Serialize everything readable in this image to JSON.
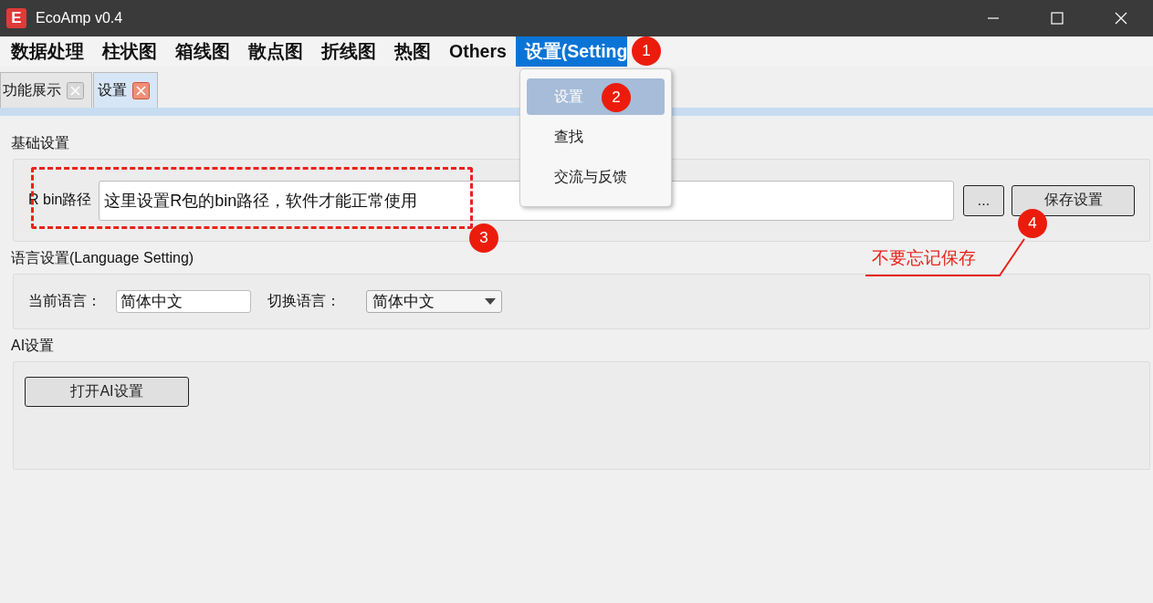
{
  "window": {
    "logo_letter": "E",
    "title": "EcoAmp v0.4"
  },
  "menu_bar": [
    {
      "label": "数据处理",
      "selected": false
    },
    {
      "label": "柱状图",
      "selected": false
    },
    {
      "label": "箱线图",
      "selected": false
    },
    {
      "label": "散点图",
      "selected": false
    },
    {
      "label": "折线图",
      "selected": false
    },
    {
      "label": "热图",
      "selected": false
    },
    {
      "label": "Others",
      "selected": false
    },
    {
      "label": "设置(Setting",
      "selected": true
    }
  ],
  "dropdown_menu": [
    {
      "label": "设置",
      "selected": true
    },
    {
      "label": "查找",
      "selected": false
    },
    {
      "label": "交流与反馈",
      "selected": false
    }
  ],
  "tabs": [
    {
      "label": "功能展示",
      "selected": false
    },
    {
      "label": "设置",
      "selected": true
    }
  ],
  "basic_settings": {
    "title": "基础设置",
    "path_label": "R bin路径",
    "path_value": "这里设置R包的bin路径，软件才能正常使用",
    "browse_button": "...",
    "save_button": "保存设置"
  },
  "language_settings": {
    "title": "语言设置(Language Setting)",
    "current_label": "当前语言：",
    "current_value": "简体中文",
    "switch_label": "切换语言：",
    "switch_value": "简体中文"
  },
  "ai_settings": {
    "title": "AI设置",
    "open_button": "打开AI设置"
  },
  "annotations": [
    {
      "number": "1"
    },
    {
      "number": "2"
    },
    {
      "number": "3"
    },
    {
      "number": "4"
    }
  ],
  "note": "不要忘记保存"
}
